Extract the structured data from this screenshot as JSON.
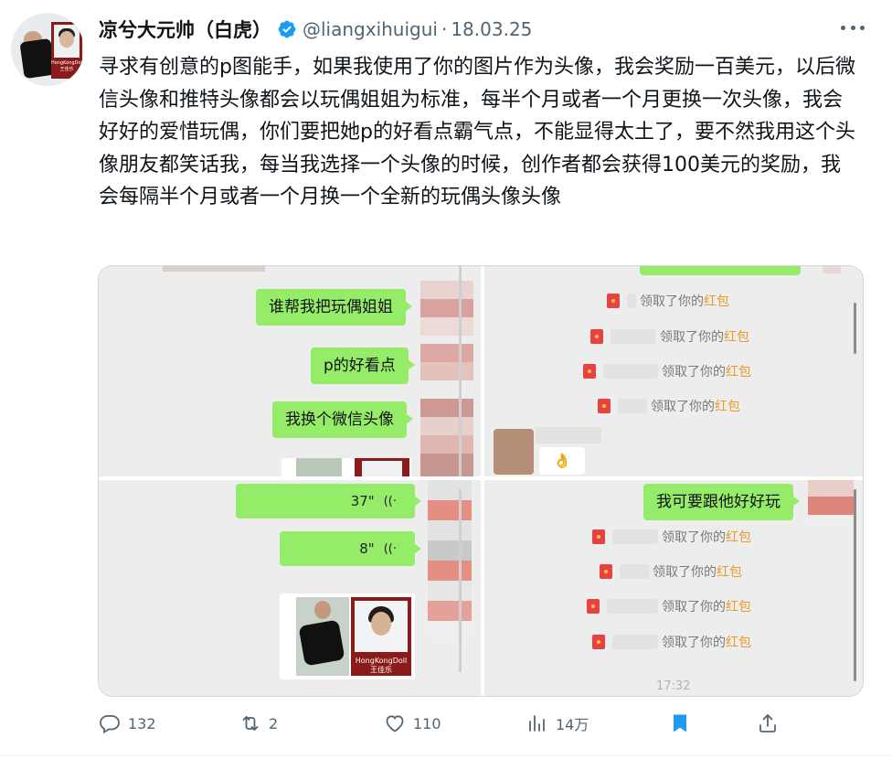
{
  "tweet": {
    "author": {
      "display_name": "凉兮大元帅（白虎）",
      "handle": "@liangxihuigui",
      "separator": "·",
      "date": "18.03.25",
      "avatar_card_text": "HongKongDoll\n王佳乐"
    },
    "text": "寻求有创意的p图能手，如果我使用了你的图片作为头像，我会奖励一百美元，以后微信头像和推特头像都会以玩偶姐姐为标准，每半个月或者一个月更换一次头像，我会好好的爱惜玩偶，你们要把她p的好看点霸气点，不能显得太土了，要不然我用这个头像朋友都笑话我，每当我选择一个头像的时候，创作者都会获得100美元的奖励，我会每隔半个月或者一个月换一个全新的玩偶头像头像",
    "media": {
      "top_left": {
        "messages": [
          "谁帮我把玩偶姐姐",
          "p的好看点",
          "我换个微信头像"
        ]
      },
      "top_right": {
        "red_packets": [
          {
            "prefix": "领取了你的",
            "highlight": "红包"
          },
          {
            "prefix": "领取了你的",
            "highlight": "红包"
          },
          {
            "prefix": "领取了你的",
            "highlight": "红包"
          },
          {
            "prefix": "领取了你的",
            "highlight": "红包"
          }
        ],
        "emoji": "👌"
      },
      "bottom_left": {
        "voice_messages": [
          {
            "duration": "37\"",
            "wave": "((·"
          },
          {
            "duration": "8\"",
            "wave": "((·"
          }
        ],
        "card_label_line1": "HongKongDoll",
        "card_label_line2": "王佳乐"
      },
      "bottom_right": {
        "message": "我可要跟他好好玩",
        "red_packets": [
          {
            "prefix": "领取了你的",
            "highlight": "红包"
          },
          {
            "prefix": "领取了你的",
            "highlight": "红包"
          },
          {
            "prefix": "领取了你的",
            "highlight": "红包"
          },
          {
            "prefix": "领取了你的",
            "highlight": "红包"
          }
        ],
        "timestamp": "17:32"
      }
    },
    "actions": {
      "replies": "132",
      "reposts": "2",
      "likes": "110",
      "views": "14万"
    },
    "colors": {
      "accent": "#1d9bf0",
      "wechat_bubble": "#95ec69",
      "red_packet_text": "#e99a2b",
      "muted": "#536471"
    }
  }
}
